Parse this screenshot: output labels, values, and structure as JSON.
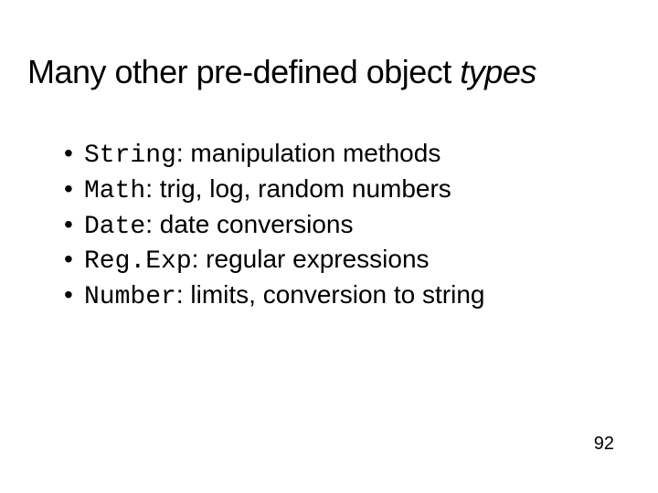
{
  "title": {
    "prefix": "Many other pre-defined object ",
    "italic": "types"
  },
  "bullets": [
    {
      "code": "String",
      "desc": ": manipulation methods"
    },
    {
      "code": "Math",
      "desc": ": trig, log, random numbers"
    },
    {
      "code": "Date",
      "desc": ": date conversions"
    },
    {
      "code": "Reg.Exp",
      "desc": ": regular expressions"
    },
    {
      "code": "Number",
      "desc": ": limits, conversion to string"
    }
  ],
  "page_number": "92",
  "bullet_glyph": "•"
}
